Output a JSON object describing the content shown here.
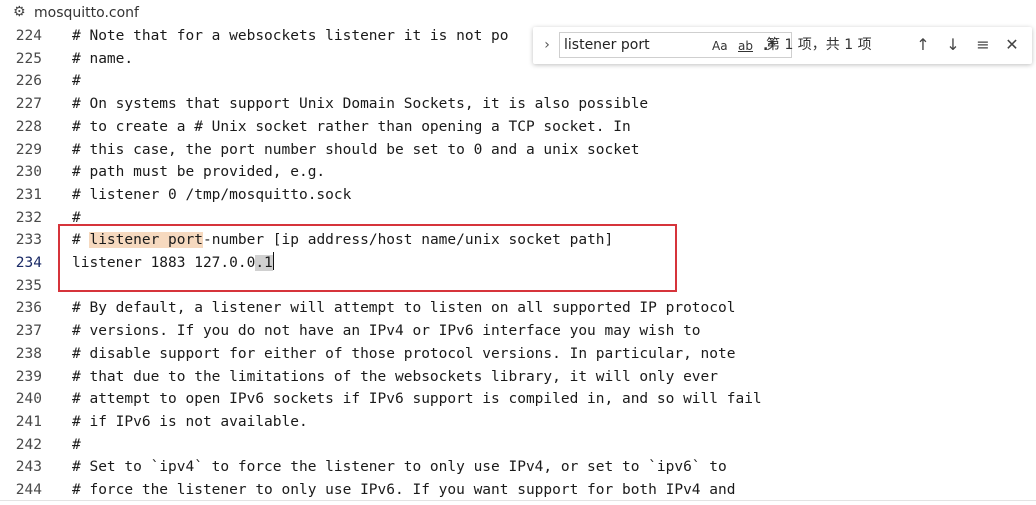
{
  "tab": {
    "file_name": "mosquitto.conf",
    "icon": "gear-icon"
  },
  "editor": {
    "lines": [
      {
        "num": "224",
        "text": "# Note that for a websockets listener it is not po"
      },
      {
        "num": "225",
        "text": "# name."
      },
      {
        "num": "226",
        "text": "#"
      },
      {
        "num": "227",
        "text": "# On systems that support Unix Domain Sockets, it is also possible"
      },
      {
        "num": "228",
        "text": "# to create a # Unix socket rather than opening a TCP socket. In"
      },
      {
        "num": "229",
        "text": "# this case, the port number should be set to 0 and a unix socket"
      },
      {
        "num": "230",
        "text": "# path must be provided, e.g."
      },
      {
        "num": "231",
        "text": "# listener 0 /tmp/mosquitto.sock"
      },
      {
        "num": "232",
        "text": "#"
      },
      {
        "num": "233",
        "pre": "# ",
        "match": "listener port",
        "post": "-number [ip address/host name/unix socket path]"
      },
      {
        "num": "234",
        "pre": "listener 1883 127.0.0",
        "sel": ".1",
        "active": true
      },
      {
        "num": "235",
        "text": ""
      },
      {
        "num": "236",
        "text": "# By default, a listener will attempt to listen on all supported IP protocol"
      },
      {
        "num": "237",
        "text": "# versions. If you do not have an IPv4 or IPv6 interface you may wish to"
      },
      {
        "num": "238",
        "text": "# disable support for either of those protocol versions. In particular, note"
      },
      {
        "num": "239",
        "text": "# that due to the limitations of the websockets library, it will only ever"
      },
      {
        "num": "240",
        "text": "# attempt to open IPv6 sockets if IPv6 support is compiled in, and so will fail"
      },
      {
        "num": "241",
        "text": "# if IPv6 is not available."
      },
      {
        "num": "242",
        "text": "#"
      },
      {
        "num": "243",
        "text": "# Set to `ipv4` to force the listener to only use IPv4, or set to `ipv6` to"
      },
      {
        "num": "244",
        "text": "# force the listener to only use IPv6. If you want support for both IPv4 and"
      }
    ]
  },
  "find_widget": {
    "query": "listener port",
    "match_case_label": "Aa",
    "whole_word_label": "ab",
    "regex_label": ".*",
    "match_count": "第 1 项，共 1 项",
    "toggle_icon": "chevron-right-icon",
    "prev_icon": "arrow-up-icon",
    "next_icon": "arrow-down-icon",
    "selection_icon": "find-in-selection-icon",
    "close_icon": "close-icon"
  },
  "colors": {
    "match_highlight": "#f6d9bf",
    "selection": "#d0d0d0",
    "annotation_box": "#d6343b",
    "active_line_number": "#1a2a66"
  }
}
